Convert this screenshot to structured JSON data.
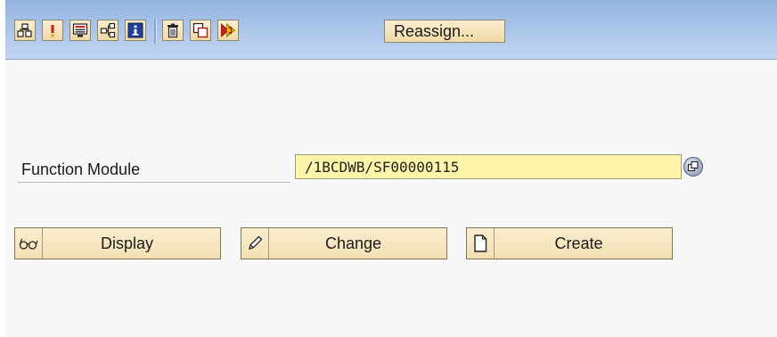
{
  "toolbar": {
    "buttons": [
      {
        "icon": "hierarchy-icon",
        "tooltip": ""
      },
      {
        "icon": "exclamation-icon",
        "tooltip": ""
      },
      {
        "icon": "screen-layout-icon",
        "tooltip": ""
      },
      {
        "icon": "transport-icon",
        "tooltip": ""
      },
      {
        "icon": "info-icon",
        "tooltip": ""
      },
      {
        "icon": "trash-icon",
        "tooltip": ""
      },
      {
        "icon": "copy-icon",
        "tooltip": ""
      },
      {
        "icon": "execute-icon",
        "tooltip": ""
      }
    ],
    "reassign_label": "Reassign..."
  },
  "form": {
    "function_module_label": "Function Module",
    "function_module_value": "/1BCDWB/SF00000115"
  },
  "actions": {
    "display_label": "Display",
    "change_label": "Change",
    "create_label": "Create"
  },
  "colors": {
    "toolbar_bg": "#a9c4ea",
    "button_bg": "#f3dfb2",
    "input_bg": "#fff5a8",
    "page_bg": "#f7f7f7"
  }
}
